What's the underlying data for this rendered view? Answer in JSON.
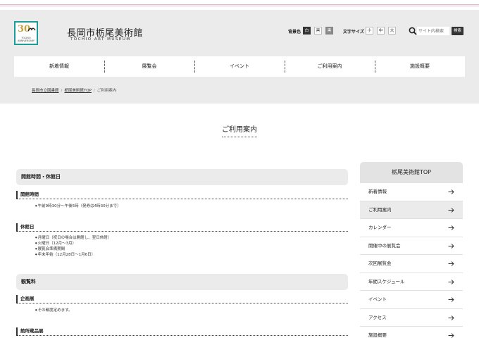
{
  "header": {
    "logo_number": "30",
    "logo_sub": "TOCHIO ANNIVERSARY",
    "title": "長岡市栃尾美術館",
    "subtitle": "TOCHIO ART MUSEUM",
    "bg_color_label": "背景色",
    "bg_options": [
      "白",
      "黒",
      "黒"
    ],
    "font_size_label": "文字サイズ",
    "font_options": [
      "小",
      "中",
      "大"
    ],
    "search_placeholder": "サイト内検索",
    "search_button": "検索"
  },
  "nav": [
    "新着情報",
    "展覧会",
    "イベント",
    "ご利用案内",
    "施設概要"
  ],
  "breadcrumb": {
    "items": [
      "長岡市立図書館",
      "栃尾美術館TOP",
      "ご利用案内"
    ],
    "separator": "/"
  },
  "page_title": "ご利用案内",
  "content": {
    "section1": {
      "title": "開館時間・休館日",
      "hours_title": "開館時間",
      "hours_items": [
        "午前9時30分〜午後5時（発券は4時30分まで）"
      ],
      "closed_title": "休館日",
      "closed_items": [
        "月曜日（祝日の場合は開館し、翌日休館）",
        "火曜日（12月〜3月）",
        "展覧会準備期間",
        "年末年始（12月28日〜1月6日）"
      ]
    },
    "section2": {
      "title": "観覧料",
      "special_title": "企画展",
      "special_items": [
        "その都度定めます。"
      ],
      "collection_title": "館所蔵品展"
    }
  },
  "sidebar": {
    "title": "栃尾美術館TOP",
    "items": [
      "新着情報",
      "ご利用案内",
      "カレンダー",
      "開催中の展覧会",
      "次回展覧会",
      "年間スケジュール",
      "イベント",
      "アクセス",
      "施設概要"
    ]
  },
  "colors": {
    "accent_teal": "#1a9e97",
    "header_bg": "#ebebeb",
    "top_line": "#e7b9c5"
  }
}
